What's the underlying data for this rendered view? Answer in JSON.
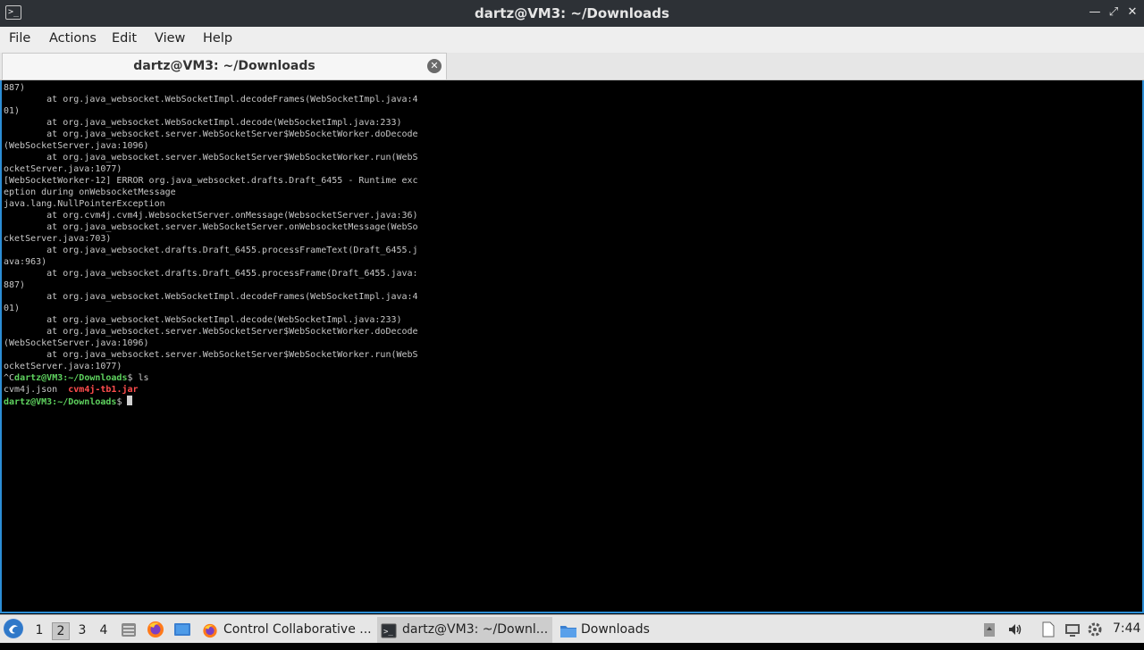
{
  "window": {
    "title": "dartz@VM3: ~/Downloads",
    "controls": [
      "minimize",
      "maximize",
      "close"
    ]
  },
  "menu": {
    "items": [
      "File",
      "Actions",
      "Edit",
      "View",
      "Help"
    ]
  },
  "tab": {
    "label": "dartz@VM3: ~/Downloads"
  },
  "terminal": {
    "lines": [
      "887)",
      "        at org.java_websocket.WebSocketImpl.decodeFrames(WebSocketImpl.java:4",
      "01)",
      "        at org.java_websocket.WebSocketImpl.decode(WebSocketImpl.java:233)",
      "        at org.java_websocket.server.WebSocketServer$WebSocketWorker.doDecode",
      "(WebSocketServer.java:1096)",
      "        at org.java_websocket.server.WebSocketServer$WebSocketWorker.run(WebS",
      "ocketServer.java:1077)",
      "[WebSocketWorker-12] ERROR org.java_websocket.drafts.Draft_6455 - Runtime exc",
      "eption during onWebsocketMessage",
      "java.lang.NullPointerException",
      "        at org.cvm4j.cvm4j.WebsocketServer.onMessage(WebsocketServer.java:36)",
      "        at org.java_websocket.server.WebSocketServer.onWebsocketMessage(WebSo",
      "cketServer.java:703)",
      "        at org.java_websocket.drafts.Draft_6455.processFrameText(Draft_6455.j",
      "ava:963)",
      "        at org.java_websocket.drafts.Draft_6455.processFrame(Draft_6455.java:",
      "887)",
      "        at org.java_websocket.WebSocketImpl.decodeFrames(WebSocketImpl.java:4",
      "01)",
      "        at org.java_websocket.WebSocketImpl.decode(WebSocketImpl.java:233)",
      "        at org.java_websocket.server.WebSocketServer$WebSocketWorker.doDecode",
      "(WebSocketServer.java:1096)",
      "        at org.java_websocket.server.WebSocketServer$WebSocketWorker.run(WebS",
      "ocketServer.java:1077)"
    ],
    "ctrl_c": "^C",
    "prompt": "dartz@VM3:~/Downloads",
    "prompt_symbol": "$ ",
    "command": "ls",
    "files": {
      "json": "cvm4j.json",
      "jar": "cvm4j-tb1.jar"
    },
    "colors": {
      "prompt": "#5fd35f",
      "jar": "#ff4d4d",
      "text": "#c7c7c7"
    }
  },
  "taskbar": {
    "start_icon": "lxqt-start-icon",
    "workspaces": [
      "1",
      "2",
      "3",
      "4"
    ],
    "active_workspace": "2",
    "quick_launch": [
      "file-manager-icon",
      "firefox-icon",
      "show-desktop-icon"
    ],
    "tasks": [
      {
        "label": "Control Collaborative ...",
        "icon": "firefox-icon"
      },
      {
        "label": "dartz@VM3: ~/Downl...",
        "icon": "terminal-icon",
        "active": true
      },
      {
        "label": "Downloads",
        "icon": "folder-icon"
      }
    ],
    "tray": [
      "clipboard-icon",
      "volume-icon",
      "notes-icon",
      "network-icon",
      "settings-icon"
    ],
    "clock": "7:44"
  }
}
